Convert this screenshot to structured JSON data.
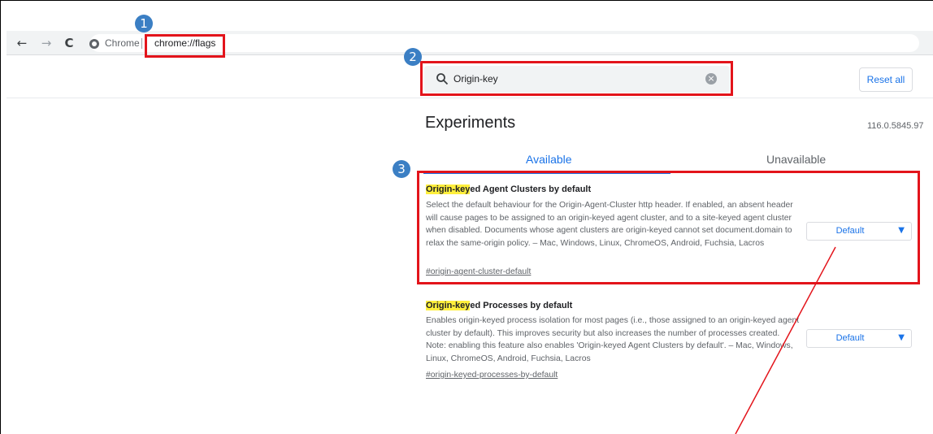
{
  "browser": {
    "tab_label": "Chrome",
    "url": "chrome://flags"
  },
  "annotations": {
    "step1": "1",
    "step2": "2",
    "step3": "3"
  },
  "search": {
    "value": "Origin-key"
  },
  "header": {
    "reset_label": "Reset all",
    "title": "Experiments",
    "version": "116.0.5845.97"
  },
  "tabs": {
    "available": "Available",
    "unavailable": "Unavailable"
  },
  "experiments": [
    {
      "name_highlight": "Origin-key",
      "name_rest": "ed Agent Clusters by default",
      "description": "Select the default behaviour for the Origin-Agent-Cluster http header. If enabled, an absent header will cause pages to be assigned to an origin-keyed agent cluster, and to a site-keyed agent cluster when disabled. Documents whose agent clusters are origin-keyed cannot set document.domain to relax the same-origin policy. – Mac, Windows, Linux, ChromeOS, Android, Fuchsia, Lacros",
      "link": "#origin-agent-cluster-default",
      "select_value": "Default"
    },
    {
      "name_highlight": "Origin-key",
      "name_rest": "ed Processes by default",
      "description": "Enables origin-keyed process isolation for most pages (i.e., those assigned to an origin-keyed agent cluster by default). This improves security but also increases the number of processes created. Note: enabling this feature also enables 'Origin-keyed Agent Clusters by default'. – Mac, Windows, Linux, ChromeOS, Android, Fuchsia, Lacros",
      "link": "#origin-keyed-processes-by-default",
      "select_value": "Default"
    }
  ],
  "colors": {
    "annotation_red": "#e3141b",
    "annotation_blue": "#3b7fc4",
    "accent_blue": "#1a73e8",
    "highlight_yellow": "#ffef3d"
  }
}
